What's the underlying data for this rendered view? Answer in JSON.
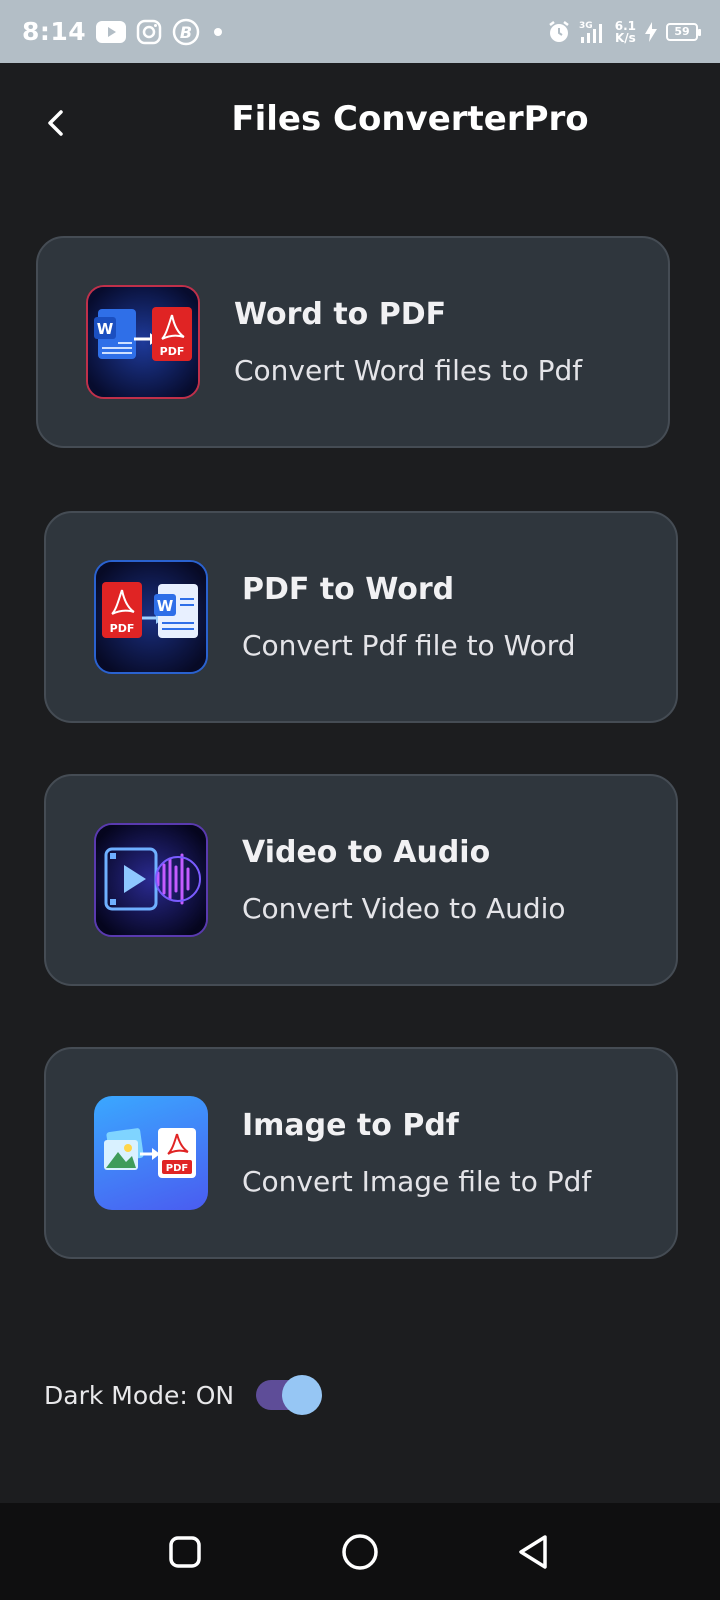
{
  "status_bar": {
    "time": "8:14",
    "net_speed_top": "6.1",
    "net_speed_bottom": "K/s",
    "network_type": "3G",
    "battery": "59",
    "icons": [
      "youtube-icon",
      "instagram-icon",
      "b-app-icon",
      "dot-icon",
      "alarm-icon",
      "signal-icon",
      "charging-icon",
      "battery-icon"
    ]
  },
  "header": {
    "title": "Files ConverterPro",
    "back_icon": "chevron-left-icon"
  },
  "converters": [
    {
      "title": "Word to PDF",
      "subtitle": "Convert Word files to Pdf",
      "icon": "word-to-pdf-icon",
      "icon_letter_a": "W",
      "icon_letter_b": "PDF"
    },
    {
      "title": "PDF to Word",
      "subtitle": "Convert Pdf file to Word",
      "icon": "pdf-to-word-icon",
      "icon_letter_a": "PDF",
      "icon_letter_b": "W"
    },
    {
      "title": "Video to Audio",
      "subtitle": "Convert Video to Audio",
      "icon": "video-to-audio-icon"
    },
    {
      "title": "Image to Pdf",
      "subtitle": "Convert Image file to Pdf",
      "icon": "image-to-pdf-icon",
      "icon_letter_b": "PDF"
    }
  ],
  "dark_mode": {
    "label": "Dark Mode: ON",
    "enabled": true
  },
  "nav": {
    "icons": [
      "recents-square-icon",
      "home-circle-icon",
      "back-triangle-icon"
    ]
  },
  "colors": {
    "background": "#1c1d1f",
    "card": "#2f363d",
    "toggle_track": "#5e4d98",
    "toggle_knob": "#96c6f4",
    "status_bar": "#b3bec6"
  }
}
